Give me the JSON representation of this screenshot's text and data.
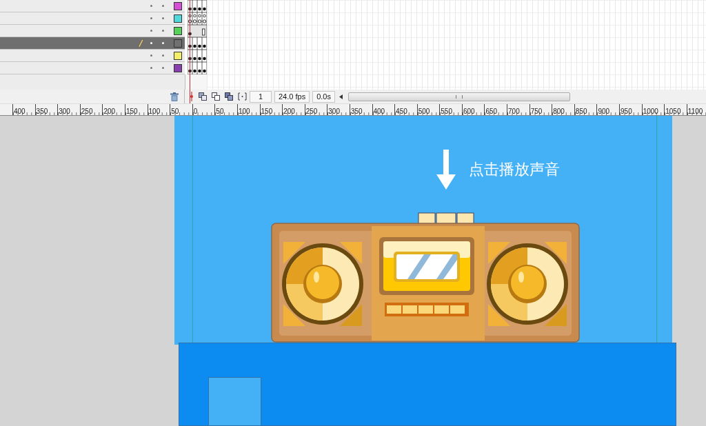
{
  "layers": [
    {
      "color": "#d44fd6",
      "selected": false,
      "kind": "keyframes"
    },
    {
      "color": "#50d8dc",
      "selected": false,
      "kind": "labeled"
    },
    {
      "color": "#56d15a",
      "selected": false,
      "kind": "single"
    },
    {
      "color": "#707070",
      "selected": true,
      "kind": "keyframes"
    },
    {
      "color": "#f3ef6a",
      "selected": false,
      "kind": "keyframes"
    },
    {
      "color": "#8a3fae",
      "selected": false,
      "kind": "keyframes"
    }
  ],
  "timeline_toolbar": {
    "frame": "1",
    "frame_rate": "24.0 fps",
    "time": "0.0s"
  },
  "ruler": {
    "labels": [
      "400",
      "350",
      "300",
      "250",
      "200",
      "150",
      "100",
      "50",
      "0",
      "50",
      "100",
      "150",
      "200",
      "250",
      "300",
      "350",
      "400",
      "450",
      "500",
      "550",
      "600",
      "650",
      "700",
      "750",
      "800",
      "850",
      "900",
      "950",
      "1000",
      "1050",
      "1100"
    ]
  },
  "stage": {
    "hint": "点击播放声音"
  }
}
